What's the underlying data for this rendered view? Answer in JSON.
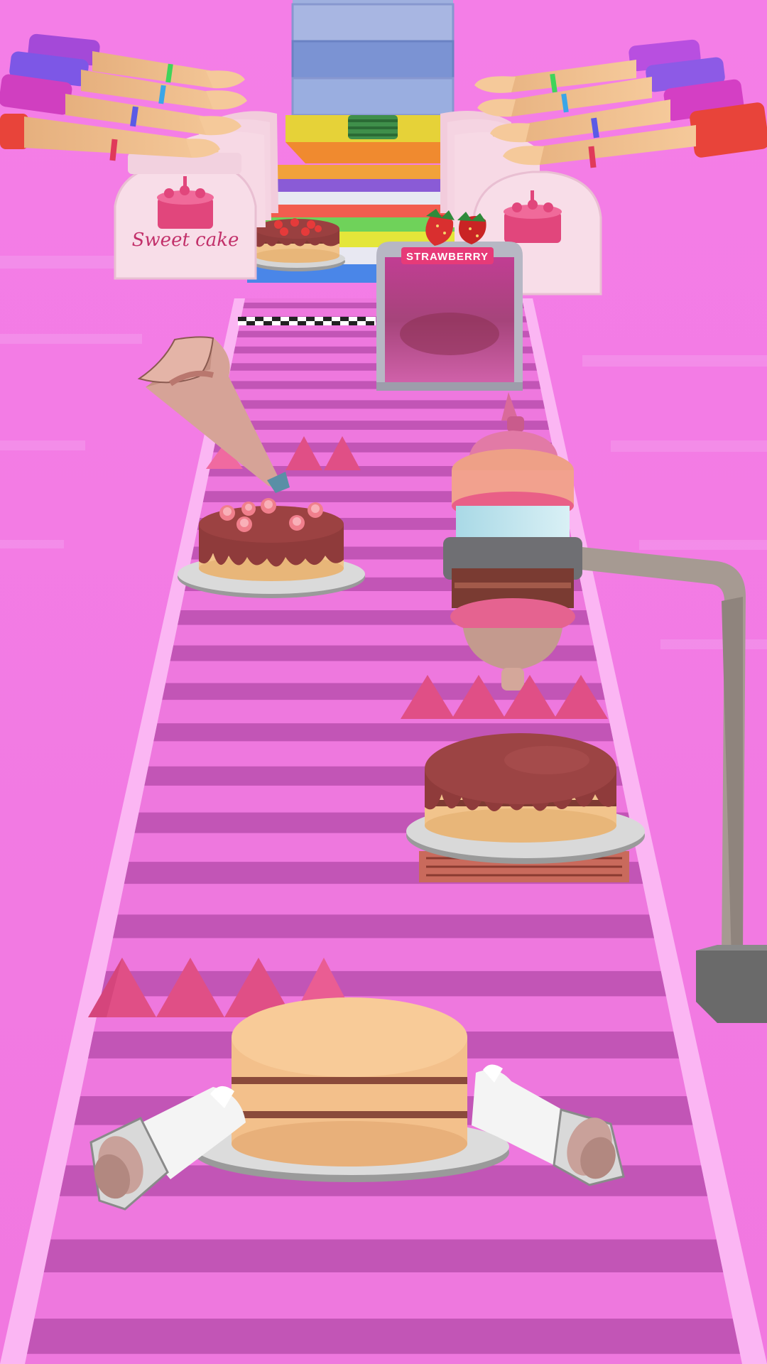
{
  "game": {
    "gate_label": "STRAWBERRY",
    "box_brand": "Sweet cake"
  },
  "colors": {
    "background": "#f47fe6",
    "runway_stripe_dark": "#c255b6",
    "runway_stripe_light": "#ee78de",
    "spike": "#e04f86",
    "gate_badge": "#e73a78",
    "cake_sponge": "#f6c590",
    "chocolate_glaze": "#8c3c3c"
  },
  "icons": {
    "piping_bag": "piping-bag-icon",
    "icing_machine": "icing-machine-icon",
    "strawberry": "strawberry-icon",
    "cake_box": "cake-box-icon",
    "finish_line": "finish-line-icon",
    "player_hands": "glove-icon"
  }
}
